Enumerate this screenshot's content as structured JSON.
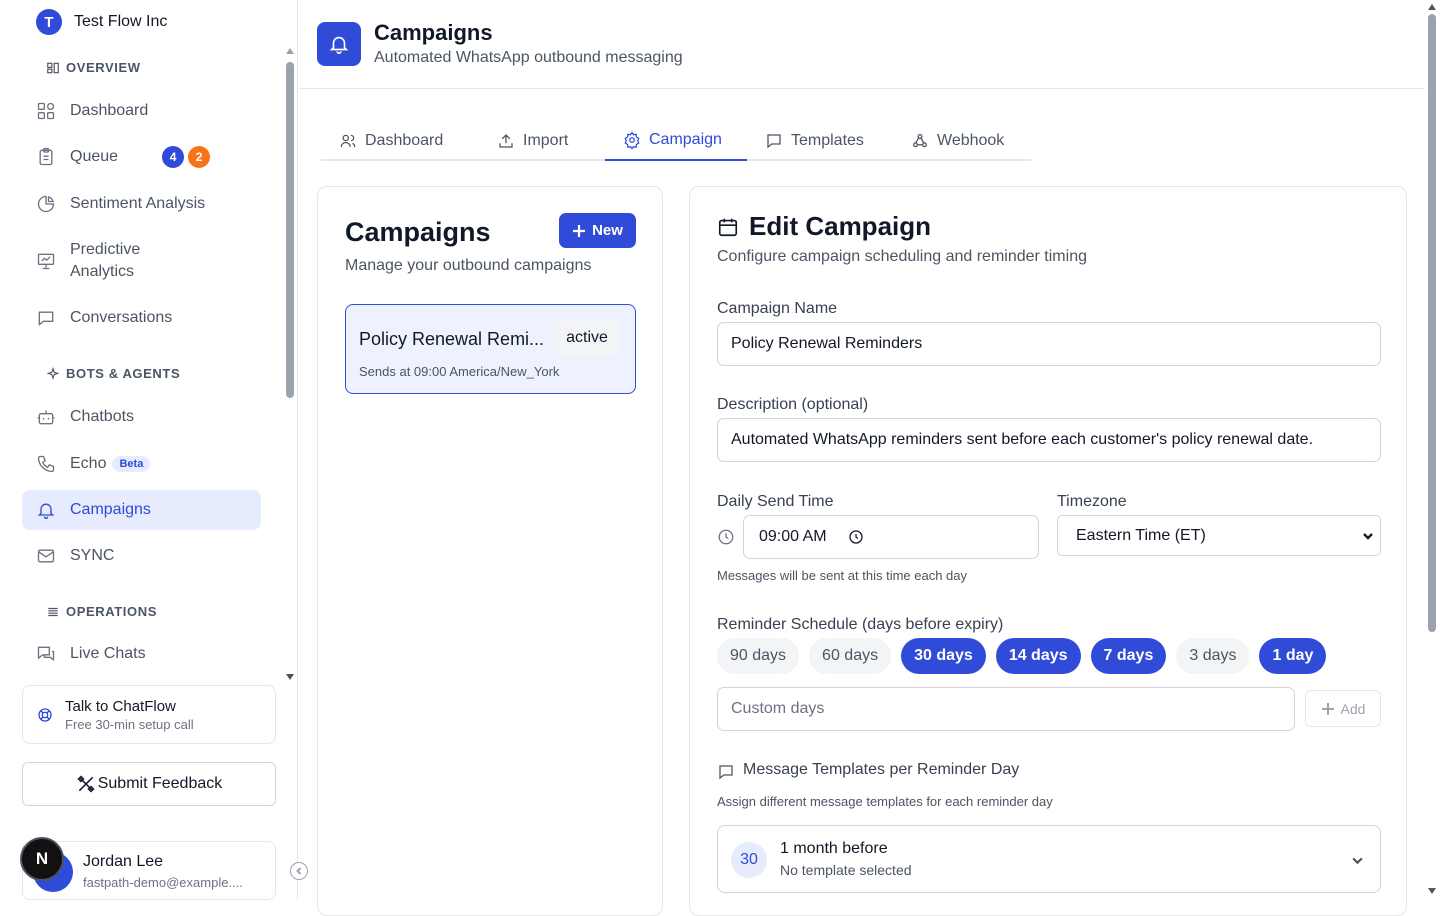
{
  "org": {
    "initial": "T",
    "name": "Test Flow Inc"
  },
  "sidebar": {
    "sections": {
      "overview": "OVERVIEW",
      "bots": "BOTS & AGENTS",
      "operations": "OPERATIONS"
    },
    "items": [
      {
        "label": "Dashboard",
        "icon": "dashboard-icon"
      },
      {
        "label": "Queue",
        "icon": "clipboard-icon",
        "badges": [
          "4",
          "2"
        ]
      },
      {
        "label": "Sentiment Analysis",
        "icon": "pie-chart-icon"
      },
      {
        "label": "Predictive Analytics",
        "icon": "presentation-chart-icon"
      },
      {
        "label": "Conversations",
        "icon": "chat-icon"
      },
      {
        "label": "Chatbots",
        "icon": "bot-icon"
      },
      {
        "label": "Echo",
        "icon": "phone-icon",
        "tag": "Beta"
      },
      {
        "label": "Campaigns",
        "icon": "bell-icon",
        "active": true
      },
      {
        "label": "SYNC",
        "icon": "mail-icon"
      },
      {
        "label": "Live Chats",
        "icon": "chats-icon"
      }
    ],
    "badge_colors": [
      "#2f4bd8",
      "#f97316"
    ],
    "talk": {
      "title": "Talk to ChatFlow",
      "subtitle": "Free 30-min setup call"
    },
    "feedback_label": "Submit Feedback",
    "user": {
      "name": "Jordan Lee",
      "email": "fastpath-demo@example...."
    },
    "next_badge": "N"
  },
  "header": {
    "title": "Campaigns",
    "subtitle": "Automated WhatsApp outbound messaging"
  },
  "tabs": [
    {
      "label": "Dashboard",
      "icon": "users-icon"
    },
    {
      "label": "Import",
      "icon": "upload-icon"
    },
    {
      "label": "Campaign",
      "icon": "gear-icon",
      "active": true
    },
    {
      "label": "Templates",
      "icon": "message-icon"
    },
    {
      "label": "Webhook",
      "icon": "webhook-icon"
    }
  ],
  "campaigns_panel": {
    "title": "Campaigns",
    "subtitle": "Manage your outbound campaigns",
    "new_label": "New",
    "campaign": {
      "name": "Policy Renewal Remi...",
      "status": "active",
      "schedule": "Sends at 09:00 America/New_York"
    }
  },
  "edit_panel": {
    "title": "Edit Campaign",
    "subtitle": "Configure campaign scheduling and reminder timing",
    "name_label": "Campaign Name",
    "name_value": "Policy Renewal Reminders",
    "desc_label": "Description (optional)",
    "desc_value": "Automated WhatsApp reminders sent before each customer's policy renewal date.",
    "time_label": "Daily Send Time",
    "time_value": "09:00  AM",
    "tz_label": "Timezone",
    "tz_value": "Eastern Time (ET)",
    "time_hint": "Messages will be sent at this time each day",
    "schedule_label": "Reminder Schedule (days before expiry)",
    "chips": [
      {
        "label": "90 days",
        "selected": false
      },
      {
        "label": "60 days",
        "selected": false
      },
      {
        "label": "30 days",
        "selected": true
      },
      {
        "label": "14 days",
        "selected": true
      },
      {
        "label": "7 days",
        "selected": true
      },
      {
        "label": "3 days",
        "selected": false
      },
      {
        "label": "1 day",
        "selected": true
      }
    ],
    "custom_placeholder": "Custom days",
    "add_label": "Add",
    "templates_title": "Message Templates per Reminder Day",
    "templates_hint": "Assign different message templates for each reminder day",
    "reminder": {
      "days": "30",
      "title": "1 month before",
      "subtitle": "No template selected"
    }
  },
  "colors": {
    "accent": "#2f4bd8",
    "accent_light": "#e6ecfd",
    "badge_orange": "#f97316"
  }
}
